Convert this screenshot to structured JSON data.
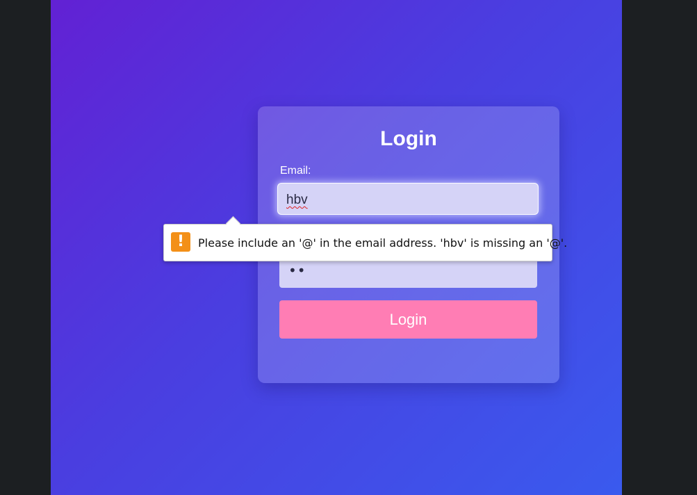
{
  "login": {
    "title": "Login",
    "email_label": "Email:",
    "email_value": "hbv",
    "password_value": "••",
    "button_label": "Login"
  },
  "validation": {
    "message": "Please include an '@' in the email address. 'hbv' is missing an '@'.",
    "icon": "warning-icon",
    "icon_glyph": "!",
    "icon_color": "#f39018"
  },
  "colors": {
    "gradient_start": "#6221d4",
    "gradient_end": "#3a5aee",
    "button": "#ff7db4",
    "input_bg": "#d5d3f7"
  }
}
